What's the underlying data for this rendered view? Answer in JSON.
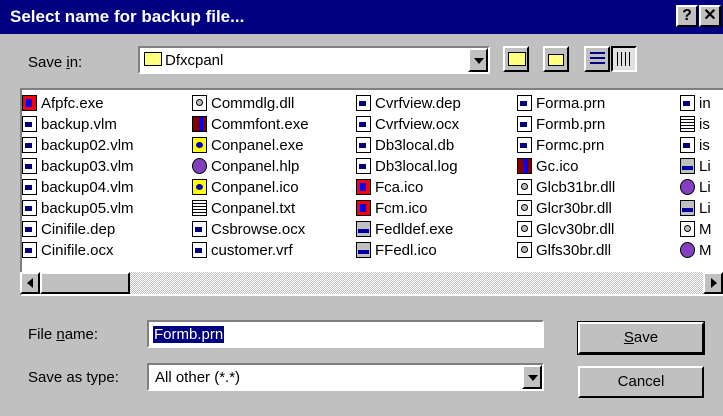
{
  "window": {
    "title": "Select name for backup file...",
    "help_label": "?",
    "close_label": "✕"
  },
  "save_in": {
    "label_pre": "Save ",
    "label_mnemonic": "i",
    "label_post": "n:",
    "value": "Dfxcpanl",
    "icon": "folder-icon"
  },
  "toolbar": {
    "up_icon": "up-folder-icon",
    "new_folder_icon": "new-folder-icon",
    "list_icon": "list-view-icon",
    "details_icon": "details-view-icon"
  },
  "files": {
    "col1": [
      {
        "name": "Afpfc.exe",
        "icon": "red"
      },
      {
        "name": "backup.vlm",
        "icon": "doc"
      },
      {
        "name": "backup02.vlm",
        "icon": "doc"
      },
      {
        "name": "backup03.vlm",
        "icon": "doc"
      },
      {
        "name": "backup04.vlm",
        "icon": "doc"
      },
      {
        "name": "backup05.vlm",
        "icon": "doc"
      },
      {
        "name": "Cinifile.dep",
        "icon": "doc"
      },
      {
        "name": "Cinifile.ocx",
        "icon": "doc"
      }
    ],
    "col2": [
      {
        "name": "Commdlg.dll",
        "icon": "dll"
      },
      {
        "name": "Commfont.exe",
        "icon": "gcico"
      },
      {
        "name": "Conpanel.exe",
        "icon": "conico"
      },
      {
        "name": "Conpanel.hlp",
        "icon": "hlp"
      },
      {
        "name": "Conpanel.ico",
        "icon": "conico"
      },
      {
        "name": "Conpanel.txt",
        "icon": "txt"
      },
      {
        "name": "Csbrowse.ocx",
        "icon": "doc"
      },
      {
        "name": "customer.vrf",
        "icon": "doc"
      }
    ],
    "col3": [
      {
        "name": "Cvrfview.dep",
        "icon": "doc"
      },
      {
        "name": "Cvrfview.ocx",
        "icon": "doc"
      },
      {
        "name": "Db3local.db",
        "icon": "doc"
      },
      {
        "name": "Db3local.log",
        "icon": "doc"
      },
      {
        "name": "Fca.ico",
        "icon": "red"
      },
      {
        "name": "Fcm.ico",
        "icon": "red"
      },
      {
        "name": "Fedldef.exe",
        "icon": "fed"
      },
      {
        "name": "FFedl.ico",
        "icon": "fed"
      }
    ],
    "col4": [
      {
        "name": "Forma.prn",
        "icon": "doc"
      },
      {
        "name": "Formb.prn",
        "icon": "doc"
      },
      {
        "name": "Formc.prn",
        "icon": "doc"
      },
      {
        "name": "Gc.ico",
        "icon": "gcico"
      },
      {
        "name": "Glcb31br.dll",
        "icon": "dll"
      },
      {
        "name": "Glcr30br.dll",
        "icon": "dll"
      },
      {
        "name": "Glcv30br.dll",
        "icon": "dll"
      },
      {
        "name": "Glfs30br.dll",
        "icon": "dll"
      }
    ],
    "col5": [
      {
        "name": "in",
        "icon": "doc"
      },
      {
        "name": "is",
        "icon": "txt"
      },
      {
        "name": "is",
        "icon": "doc"
      },
      {
        "name": "Li",
        "icon": "fed"
      },
      {
        "name": "Li",
        "icon": "hlp"
      },
      {
        "name": "Li",
        "icon": "fed"
      },
      {
        "name": "M",
        "icon": "dll"
      },
      {
        "name": "M",
        "icon": "hlp"
      }
    ]
  },
  "file_name": {
    "label_pre": "File ",
    "label_mnemonic": "n",
    "label_post": "ame:",
    "value": "Formb.prn"
  },
  "save_as_type": {
    "label": "Save as type:",
    "value": "All other (*.*)"
  },
  "buttons": {
    "save_mnemonic": "S",
    "save_rest": "ave",
    "cancel": "Cancel"
  }
}
